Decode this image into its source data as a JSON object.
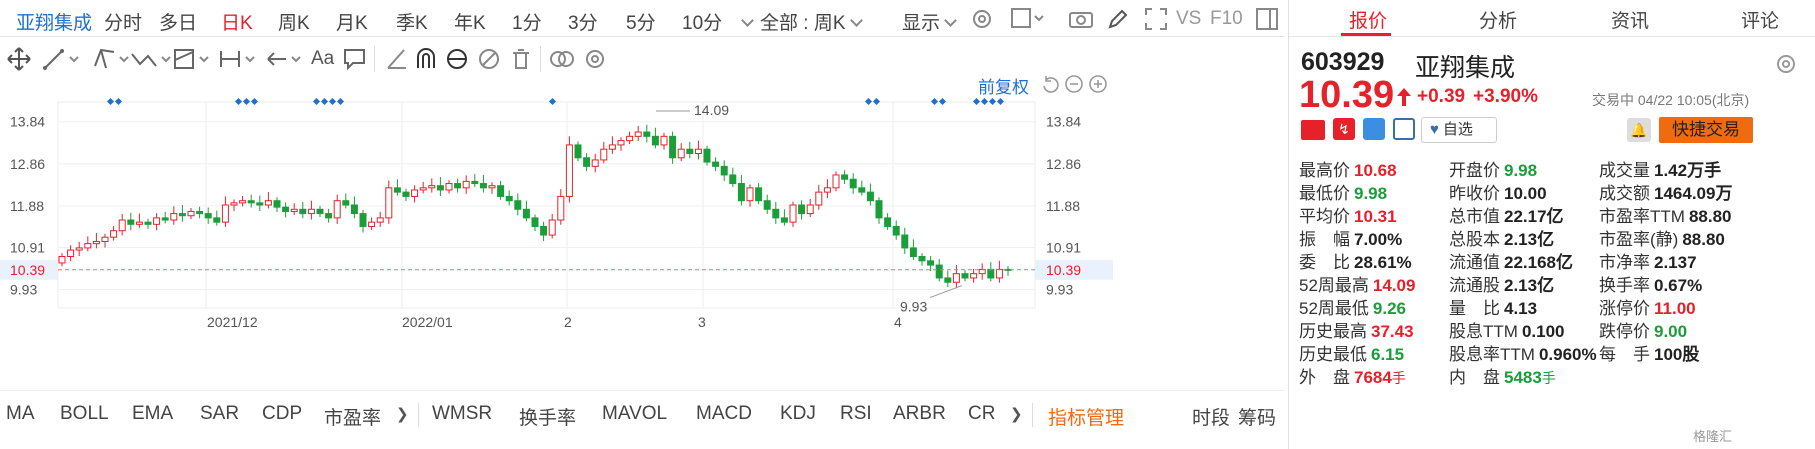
{
  "top_tabs": {
    "stock_name": "亚翔集成",
    "periods": [
      "分时",
      "多日",
      "日K",
      "周K",
      "月K",
      "季K",
      "年K",
      "1分",
      "3分",
      "5分",
      "10分"
    ],
    "active_period": "日K",
    "range_select": "全部 : 周K",
    "display_label": "显示",
    "vs_label": "VS",
    "f10_label": "F10"
  },
  "chart": {
    "adjust_label": "前复权",
    "hi_label": "14.09",
    "lo_label": "9.93",
    "price_line_label": "10.39"
  },
  "chart_data": {
    "type": "candlestick",
    "y_ticks": [
      "13.84",
      "12.86",
      "11.88",
      "10.91",
      "9.93"
    ],
    "x_tick_labels": [
      "2021/12",
      "2022/01",
      "2",
      "3",
      "4"
    ],
    "current_price": 10.39,
    "period_high": 14.09,
    "period_low": 9.93
  },
  "indicators": [
    "MA",
    "BOLL",
    "EMA",
    "SAR",
    "CDP",
    "市盈率",
    "WMSR",
    "换手率",
    "MAVOL",
    "MACD",
    "KDJ",
    "RSI",
    "ARBR",
    "CR"
  ],
  "indicator_manage": "指标管理",
  "bottom_right": [
    "时段",
    "筹码"
  ],
  "quote": {
    "tabs": [
      "报价",
      "分析",
      "资讯",
      "评论"
    ],
    "active_tab": "报价",
    "code": "603929",
    "name": "亚翔集成",
    "price": "10.39",
    "change": "+0.39",
    "change_pct": "+3.90%",
    "status": "交易中 04/22 10:05(北京)",
    "watch_label": "自选",
    "quick_trade": "快捷交易",
    "col1": [
      {
        "label": "最高价",
        "value": "10.68",
        "color": "red"
      },
      {
        "label": "最低价",
        "value": "9.98",
        "color": "green"
      },
      {
        "label": "平均价",
        "value": "10.31",
        "color": "red"
      },
      {
        "label": "振　幅",
        "value": "7.00%",
        "color": "dark"
      },
      {
        "label": "委　比",
        "value": "28.61%",
        "color": "dark"
      },
      {
        "label": "52周最高",
        "value": "14.09",
        "color": "red"
      },
      {
        "label": "52周最低",
        "value": "9.26",
        "color": "green"
      },
      {
        "label": "历史最高",
        "value": "37.43",
        "color": "red"
      },
      {
        "label": "历史最低",
        "value": "6.15",
        "color": "green"
      },
      {
        "label": "外　盘",
        "value": "7684",
        "unit": "手",
        "color": "red"
      }
    ],
    "col2": [
      {
        "label": "开盘价",
        "value": "9.98",
        "color": "green"
      },
      {
        "label": "昨收价",
        "value": "10.00",
        "color": "dark"
      },
      {
        "label": "总市值",
        "value": "22.17亿",
        "color": "dark"
      },
      {
        "label": "总股本",
        "value": "2.13亿",
        "color": "dark"
      },
      {
        "label": "流通值",
        "value": "22.168亿",
        "color": "dark"
      },
      {
        "label": "流通股",
        "value": "2.13亿",
        "color": "dark"
      },
      {
        "label": "量　比",
        "value": "4.13",
        "color": "dark"
      },
      {
        "label": "股息TTM",
        "value": "0.100",
        "color": "dark"
      },
      {
        "label": "股息率TTM",
        "value": "0.960%",
        "color": "dark"
      },
      {
        "label": "内　盘",
        "value": "5483",
        "unit": "手",
        "color": "green"
      }
    ],
    "col3": [
      {
        "label": "成交量",
        "value": "1.42万手",
        "color": "dark"
      },
      {
        "label": "成交额",
        "value": "1464.09万",
        "color": "dark"
      },
      {
        "label": "市盈率TTM",
        "value": "88.80",
        "color": "dark"
      },
      {
        "label": "市盈率(静)",
        "value": "88.80",
        "color": "dark"
      },
      {
        "label": "市净率",
        "value": "2.137",
        "color": "dark"
      },
      {
        "label": "换手率",
        "value": "0.67%",
        "color": "dark"
      },
      {
        "label": "涨停价",
        "value": "11.00",
        "color": "red"
      },
      {
        "label": "跌停价",
        "value": "9.00",
        "color": "green"
      },
      {
        "label": "每　手",
        "value": "100股",
        "color": "dark"
      }
    ],
    "watermark": "格隆汇"
  },
  "colors": {
    "up": "#e6212a",
    "down": "#1a9e3a",
    "accent": "#1f6fd1",
    "orange": "#f06a0f"
  }
}
